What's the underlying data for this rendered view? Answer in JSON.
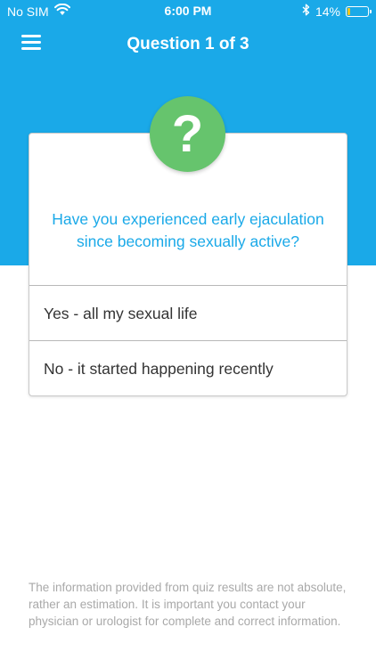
{
  "status_bar": {
    "carrier": "No SIM",
    "time": "6:00 PM",
    "battery_percent": "14%",
    "battery_level": 0.14,
    "battery_color": "#f5c518",
    "wifi_icon": "wifi-icon",
    "bluetooth_icon": "bluetooth-icon"
  },
  "nav": {
    "title": "Question 1 of 3",
    "menu_icon": "hamburger-menu-icon"
  },
  "quiz": {
    "badge_symbol": "?",
    "question": "Have you experienced early ejaculation since becoming sexually active?",
    "answers": [
      {
        "label": "Yes - all my sexual life"
      },
      {
        "label": "No - it started happening recently"
      }
    ]
  },
  "disclaimer": "The information provided from quiz results are not absolute, rather an estimation. It is important you contact your physician or urologist for complete and correct information.",
  "colors": {
    "header_blue": "#1aa9e8",
    "badge_green": "#66c46d",
    "question_text": "#1aa9e8",
    "disclaimer_text": "#a9a9a9"
  }
}
